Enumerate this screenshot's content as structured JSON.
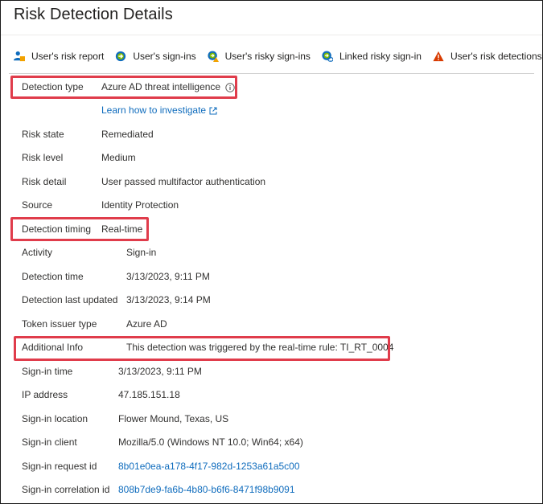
{
  "page": {
    "title": "Risk Detection Details"
  },
  "toolbar": {
    "items": [
      {
        "label": "User's risk report",
        "icon": "user-report-icon"
      },
      {
        "label": "User's sign-ins",
        "icon": "sign-in-icon"
      },
      {
        "label": "User's risky sign-ins",
        "icon": "risky-sign-in-icon"
      },
      {
        "label": "Linked risky sign-in",
        "icon": "linked-sign-in-icon"
      },
      {
        "label": "User's risk detections",
        "icon": "warning-icon"
      }
    ]
  },
  "details": {
    "detection_type": {
      "label": "Detection type",
      "value": "Azure AD threat intelligence"
    },
    "learn_link": "Learn how to investigate",
    "risk_state": {
      "label": "Risk state",
      "value": "Remediated"
    },
    "risk_level": {
      "label": "Risk level",
      "value": "Medium"
    },
    "risk_detail": {
      "label": "Risk detail",
      "value": "User passed multifactor authentication"
    },
    "source": {
      "label": "Source",
      "value": "Identity Protection"
    },
    "detection_timing": {
      "label": "Detection timing",
      "value": "Real-time"
    },
    "activity": {
      "label": "Activity",
      "value": "Sign-in"
    },
    "detection_time": {
      "label": "Detection time",
      "value": "3/13/2023, 9:11 PM"
    },
    "detection_last_updated": {
      "label": "Detection last updated",
      "value": "3/13/2023, 9:14 PM"
    },
    "token_issuer_type": {
      "label": "Token issuer type",
      "value": "Azure AD"
    },
    "additional_info": {
      "label": "Additional Info",
      "value": "This detection was triggered by the real-time rule: TI_RT_0004"
    },
    "sign_in_time": {
      "label": "Sign-in time",
      "value": "3/13/2023, 9:11 PM"
    },
    "ip_address": {
      "label": "IP address",
      "value": "47.185.151.18"
    },
    "sign_in_location": {
      "label": "Sign-in location",
      "value": "Flower Mound, Texas, US"
    },
    "sign_in_client": {
      "label": "Sign-in client",
      "value": "Mozilla/5.0 (Windows NT 10.0; Win64; x64)"
    },
    "sign_in_request_id": {
      "label": "Sign-in request id",
      "value": "8b01e0ea-a178-4f17-982d-1253a61a5c00"
    },
    "sign_in_correlation_id": {
      "label": "Sign-in correlation id",
      "value": "808b7de9-fa6b-4b80-b6f6-8471f98b9091"
    }
  },
  "colors": {
    "link": "#0f6cbd",
    "highlight": "#e03c4b",
    "warning": "#d83b01"
  }
}
